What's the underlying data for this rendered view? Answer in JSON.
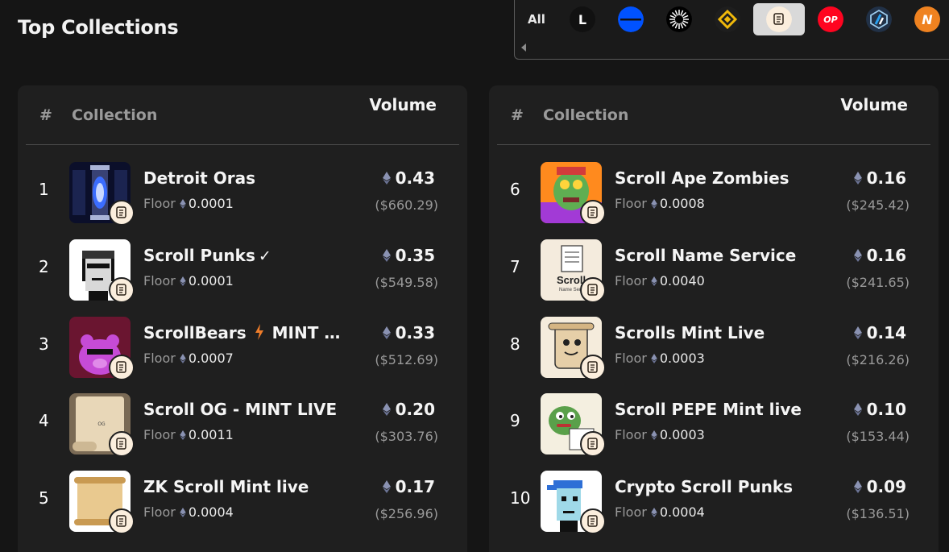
{
  "page": {
    "title": "Top Collections"
  },
  "chains": {
    "all_label": "All",
    "items": [
      {
        "name": "linea-icon",
        "glyph": "L",
        "bg": "#111111",
        "fg": "#ffffff",
        "active": false
      },
      {
        "name": "base-icon",
        "glyph": "",
        "bg": "#0052ff",
        "fg": "#ffffff",
        "active": false
      },
      {
        "name": "zksync-sunburst-icon",
        "glyph": "",
        "bg": "#000000",
        "fg": "#ffffff",
        "active": false
      },
      {
        "name": "bnb-icon",
        "glyph": "",
        "bg": "#1e1e1e",
        "fg": "#f0b90b",
        "active": false
      },
      {
        "name": "scroll-chain-icon",
        "glyph": "",
        "bg": "#fbeedd",
        "fg": "#3a2a1a",
        "active": true
      },
      {
        "name": "optimism-icon",
        "glyph": "OP",
        "bg": "#ff0420",
        "fg": "#ffffff",
        "active": false
      },
      {
        "name": "arbitrum-icon",
        "glyph": "",
        "bg": "#213147",
        "fg": "#28a0f0",
        "active": false
      },
      {
        "name": "nova-icon",
        "glyph": "N",
        "bg": "#ef8220",
        "fg": "#ffffff",
        "active": false
      }
    ]
  },
  "table": {
    "col_rank": "#",
    "col_collection": "Collection",
    "col_volume": "Volume",
    "floor_label": "Floor"
  },
  "left_rows": [
    {
      "rank": "1",
      "name": "Detroit Oras",
      "suffix": "",
      "floor": "0.0001",
      "volume": "0.43",
      "usd": "($660.29)",
      "thumb": "portal"
    },
    {
      "rank": "2",
      "name": "Scroll Punks",
      "suffix": "✓",
      "floor": "0.0001",
      "volume": "0.35",
      "usd": "($549.58)",
      "thumb": "punk"
    },
    {
      "rank": "3",
      "name": "ScrollBears",
      "suffix": "MINT LI...",
      "floor": "0.0007",
      "volume": "0.33",
      "usd": "($512.69)",
      "thumb": "bear"
    },
    {
      "rank": "4",
      "name": "Scroll OG - MINT LIVE",
      "suffix": "",
      "floor": "0.0011",
      "volume": "0.20",
      "usd": "($303.76)",
      "thumb": "og"
    },
    {
      "rank": "5",
      "name": "ZK Scroll Mint live",
      "suffix": "",
      "floor": "0.0004",
      "volume": "0.17",
      "usd": "($256.96)",
      "thumb": "parchment"
    }
  ],
  "right_rows": [
    {
      "rank": "6",
      "name": "Scroll Ape Zombies",
      "suffix": "",
      "floor": "0.0008",
      "volume": "0.16",
      "usd": "($245.42)",
      "thumb": "ape"
    },
    {
      "rank": "7",
      "name": "Scroll Name Service",
      "suffix": "",
      "floor": "0.0040",
      "volume": "0.16",
      "usd": "($241.65)",
      "thumb": "sns"
    },
    {
      "rank": "8",
      "name": "Scrolls Mint Live",
      "suffix": "",
      "floor": "0.0003",
      "volume": "0.14",
      "usd": "($216.26)",
      "thumb": "cartoon"
    },
    {
      "rank": "9",
      "name": "Scroll PEPE Mint live",
      "suffix": "",
      "floor": "0.0003",
      "volume": "0.10",
      "usd": "($153.44)",
      "thumb": "pepe"
    },
    {
      "rank": "10",
      "name": "Crypto Scroll Punks",
      "suffix": "",
      "floor": "0.0004",
      "volume": "0.09",
      "usd": "($136.51)",
      "thumb": "cpunk"
    }
  ],
  "thumb_text": {
    "sns_word": "Scroll",
    "sns_sub": "Name Serv",
    "og_text": "OG"
  },
  "colors": {
    "bg": "#151515",
    "panel": "#1f1f1f",
    "muted": "#9a9a9a",
    "eth": "#8a92b2",
    "bolt": "#ef7d2a"
  }
}
